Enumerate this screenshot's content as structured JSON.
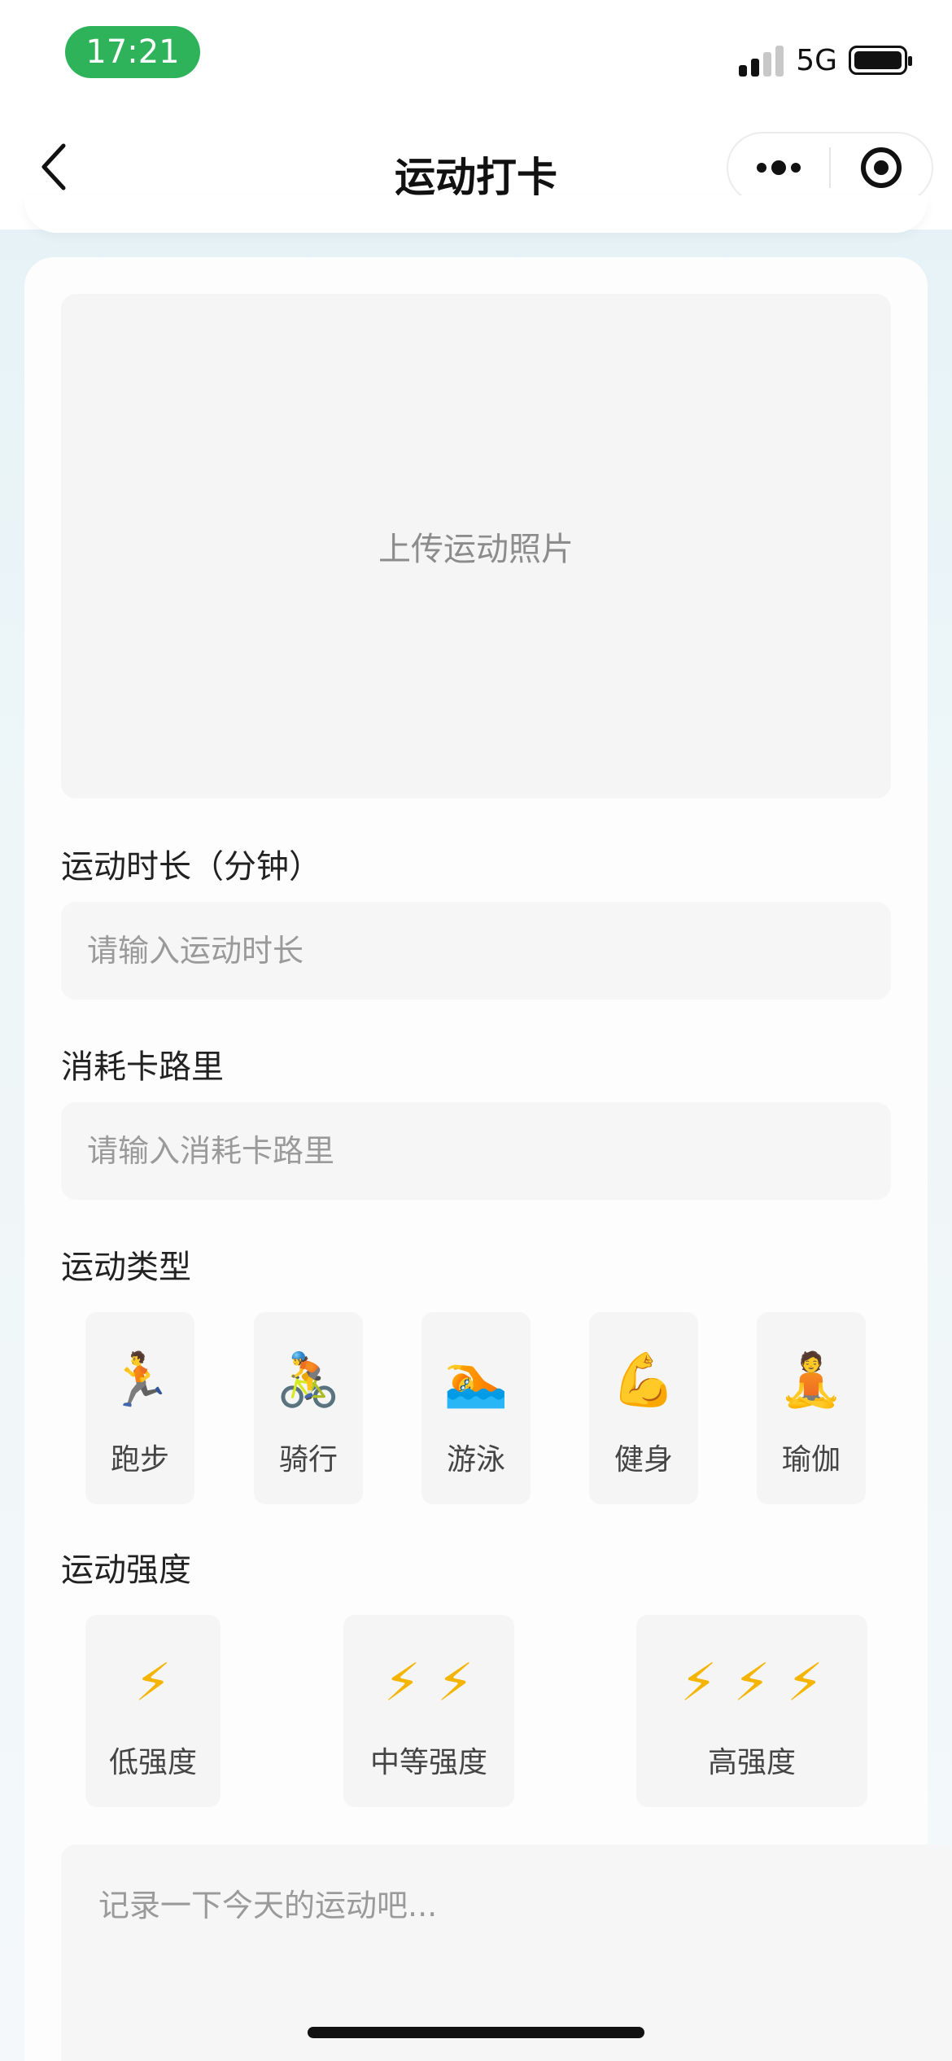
{
  "status_bar": {
    "time": "17:21",
    "network": "5G"
  },
  "nav": {
    "title": "运动打卡"
  },
  "upload": {
    "label": "上传运动照片"
  },
  "duration": {
    "label": "运动时长（分钟）",
    "placeholder": "请输入运动时长",
    "value": ""
  },
  "calories": {
    "label": "消耗卡路里",
    "placeholder": "请输入消耗卡路里",
    "value": ""
  },
  "sport_type": {
    "label": "运动类型",
    "items": [
      {
        "icon": "🏃",
        "icon_name": "running-icon",
        "label": "跑步"
      },
      {
        "icon": "🚴",
        "icon_name": "cycling-icon",
        "label": "骑行"
      },
      {
        "icon": "🏊",
        "icon_name": "swimming-icon",
        "label": "游泳"
      },
      {
        "icon": "💪",
        "icon_name": "flexed-biceps-icon",
        "label": "健身"
      },
      {
        "icon": "🧘",
        "icon_name": "yoga-icon",
        "label": "瑜伽"
      }
    ]
  },
  "intensity": {
    "label": "运动强度",
    "items": [
      {
        "icon": "⚡",
        "bolts": 1,
        "label": "低强度"
      },
      {
        "icon": "⚡ ⚡",
        "bolts": 2,
        "label": "中等强度"
      },
      {
        "icon": "⚡ ⚡ ⚡",
        "bolts": 3,
        "label": "高强度"
      }
    ]
  },
  "note": {
    "placeholder": "记录一下今天的运动吧..."
  },
  "colors": {
    "time_pill": "#2fb35a",
    "bolt": "#f4b400",
    "field_bg": "#f6f6f6",
    "page_bg": "#e3f1f6"
  }
}
